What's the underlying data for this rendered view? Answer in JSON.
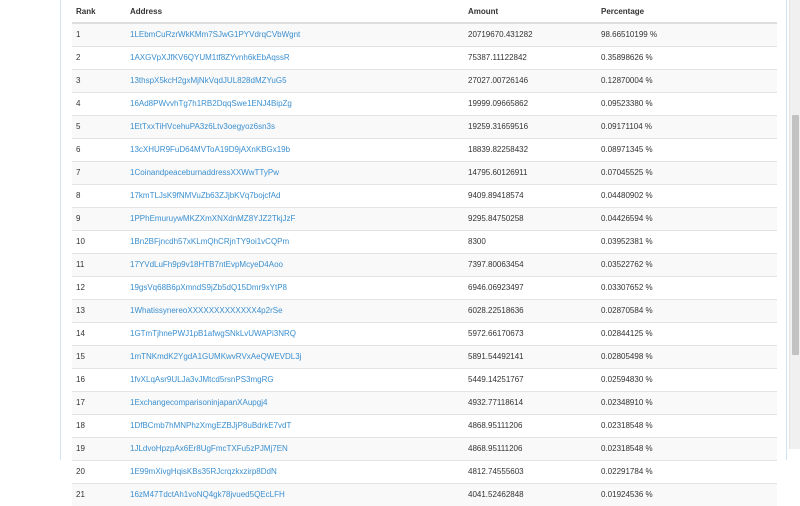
{
  "table": {
    "headers": [
      "Rank",
      "Address",
      "Amount",
      "Percentage"
    ],
    "rows": [
      {
        "rank": "1",
        "address": "1LEbmCuRzrWkKMm7SJwG1PYVdrqCVbWgnt",
        "amount": "20719670.431282",
        "percentage": "98.66510199 %"
      },
      {
        "rank": "2",
        "address": "1AXGVpXJfKV6QYUM1tf8ZYvnh6kEbAqssR",
        "amount": "75387.11122842",
        "percentage": "0.35898626 %"
      },
      {
        "rank": "3",
        "address": "13thspX5kcH2gxMjNkVqdJUL828dMZYuG5",
        "amount": "27027.00726146",
        "percentage": "0.12870004 %"
      },
      {
        "rank": "4",
        "address": "16Ad8PWvvhTg7h1RB2DqqSwe1ENJ4BipZg",
        "amount": "19999.09665862",
        "percentage": "0.09523380 %"
      },
      {
        "rank": "5",
        "address": "1EtTxxTiHVcehuPA3z6Ltv3oegyoz6sn3s",
        "amount": "19259.31659516",
        "percentage": "0.09171104 %"
      },
      {
        "rank": "6",
        "address": "13cXHUR9FuD64MVToA19D9jAXnKBGx19b",
        "amount": "18839.82258432",
        "percentage": "0.08971345 %"
      },
      {
        "rank": "7",
        "address": "1CoinandpeaceburnaddressXXWwTTyPw",
        "amount": "14795.60126911",
        "percentage": "0.07045525 %"
      },
      {
        "rank": "8",
        "address": "17kmTLJsK9fNMVuZb63ZJjbKVq7bojcfAd",
        "amount": "9409.89418574",
        "percentage": "0.04480902 %"
      },
      {
        "rank": "9",
        "address": "1PPhEmuruywMKZXmXNXdnMZ8YJZ2TkjJzF",
        "amount": "9295.84750258",
        "percentage": "0.04426594 %"
      },
      {
        "rank": "10",
        "address": "1Bn2BFjncdh57xKLmQhCRjnTY9oi1vCQPm",
        "amount": "8300",
        "percentage": "0.03952381 %"
      },
      {
        "rank": "11",
        "address": "17YVdLuFh9p9v18HTB7ntEvpMcyeD4Aoo",
        "amount": "7397.80063454",
        "percentage": "0.03522762 %"
      },
      {
        "rank": "12",
        "address": "19gsVq68B6pXmndS9jZb5dQ15Dmr9xYtP8",
        "amount": "6946.06923497",
        "percentage": "0.03307652 %"
      },
      {
        "rank": "13",
        "address": "1WhatissynereoXXXXXXXXXXXXX4p2rSe",
        "amount": "6028.22518636",
        "percentage": "0.02870584 %"
      },
      {
        "rank": "14",
        "address": "1GTmTjhnePWJ1pB1afwgSNkLvUWAPi3NRQ",
        "amount": "5972.66170673",
        "percentage": "0.02844125 %"
      },
      {
        "rank": "15",
        "address": "1mTNKmdK2YgdA1GUMKwvRVxAeQWEVDL3j",
        "amount": "5891.54492141",
        "percentage": "0.02805498 %"
      },
      {
        "rank": "16",
        "address": "1fvXLqAsr9ULJa3vJMtcd5rsnPS3mgRG",
        "amount": "5449.14251767",
        "percentage": "0.02594830 %"
      },
      {
        "rank": "17",
        "address": "1ExchangecomparisoninjapanXAupgj4",
        "amount": "4932.77118614",
        "percentage": "0.02348910 %"
      },
      {
        "rank": "18",
        "address": "1DfBCmb7hMNPhzXmgEZBJjP8uBdrkE7vdT",
        "amount": "4868.95111206",
        "percentage": "0.02318548 %"
      },
      {
        "rank": "19",
        "address": "1JLdvoHpzpAx6Er8UgFmcTXFu5zPJMj7EN",
        "amount": "4868.95111206",
        "percentage": "0.02318548 %"
      },
      {
        "rank": "20",
        "address": "1E99mXivgHqisKBs35RJcrqzkxzirp8DdN",
        "amount": "4812.74555603",
        "percentage": "0.02291784 %"
      },
      {
        "rank": "21",
        "address": "16zM47TdctAh1voNQ4gk78jvued5QEcLFH",
        "amount": "4041.52462848",
        "percentage": "0.01924536 %"
      }
    ]
  }
}
